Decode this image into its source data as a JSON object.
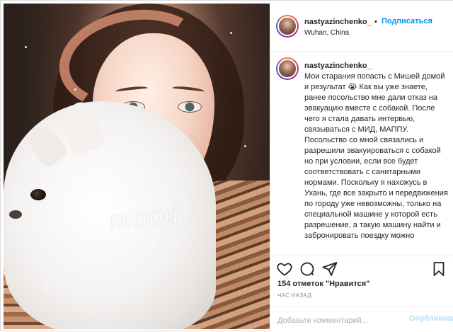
{
  "post": {
    "header": {
      "username": "nastyazinchenko_",
      "separator": "•",
      "follow_label": "Подписаться",
      "location": "Wuhan, China"
    },
    "photo": {
      "watermark": "mood."
    },
    "caption": {
      "username": "nastyazinchenko_",
      "text": "Мои старания попасть с Мишей домой и результат 😭 Как вы уже знаете, ранее посольство мне дали отказ на эвакуацию вместе с собакой. После чего я стала давать интервью, связываться с МИД, МАППУ. Посольство со мной связались и разрешили эвакуироваться с собакой но при условии, если все будет соответствовать с санитарными нормами. Поскольку я нахожусь в Ухань, где все закрыто и передвижения по городу уже невозможны, только на специальной машине у которой есть разрешение, а такую машину найти и забронировать поездку можно"
    },
    "actions": {
      "like_icon": "heart-icon",
      "comment_icon": "comment-icon",
      "share_icon": "share-icon",
      "save_icon": "bookmark-icon"
    },
    "likes_text": "154 отметок \"Нравится\"",
    "time_text": "ЧАС НАЗАД",
    "comment": {
      "placeholder": "Добавьте комментарий...",
      "publish_label": "Опубликовать"
    }
  },
  "colors": {
    "accent": "#0095f6",
    "publish_disabled": "#b2dffc",
    "muted": "#8e8e8e",
    "text": "#262626",
    "border": "#efefef"
  }
}
